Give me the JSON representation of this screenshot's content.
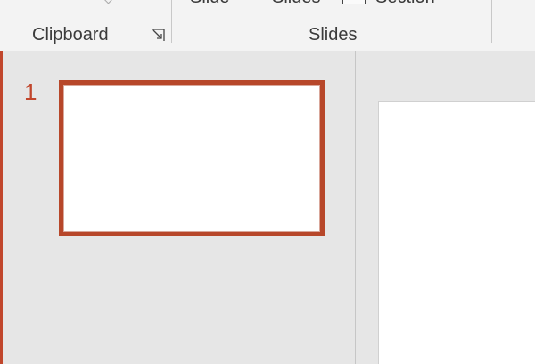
{
  "ribbon": {
    "cut_buttons": {
      "new_slide_label": "Slide",
      "reuse_slides_label": "Slides",
      "section_label": "Section"
    },
    "groups": {
      "clipboard_label": "Clipboard",
      "slides_label": "Slides"
    }
  },
  "thumbnail_pane": {
    "slides": [
      {
        "number": "1"
      }
    ]
  },
  "colors": {
    "accent": "#b7472a",
    "ribbon_bg": "#f3f3f3",
    "workspace_bg": "#e6e6e6"
  }
}
